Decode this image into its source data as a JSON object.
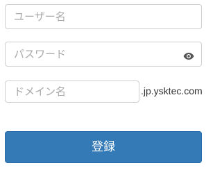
{
  "form": {
    "username": {
      "value": "",
      "placeholder": "ユーザー名"
    },
    "password": {
      "value": "",
      "placeholder": "パスワード",
      "toggle_icon": "eye-icon"
    },
    "domain": {
      "value": "",
      "placeholder": "ドメイン名",
      "suffix": ".jp.ysktec.com"
    },
    "login_label": "登録"
  },
  "colors": {
    "primary": "#337ab7",
    "border": "#cfcfcf",
    "placeholder": "#a8a8a8",
    "icon": "#555555"
  }
}
